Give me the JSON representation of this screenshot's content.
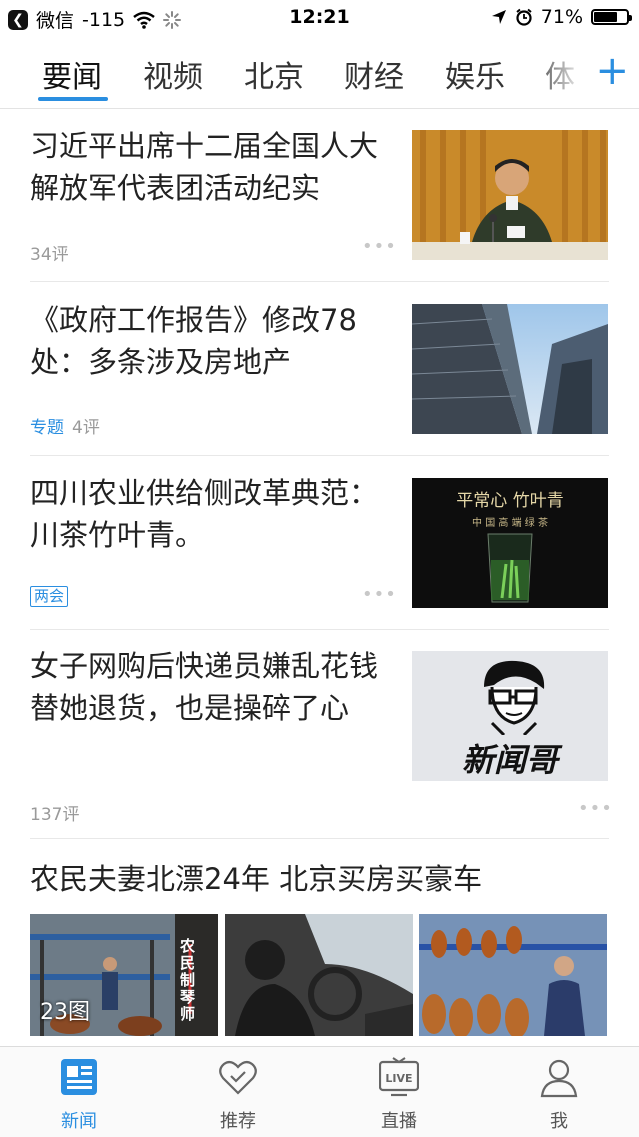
{
  "status_bar": {
    "back_app": "微信",
    "signal": "-115",
    "time": "12:21",
    "battery": "71%",
    "battery_level": 0.71
  },
  "channels": {
    "tabs": [
      "要闻",
      "视频",
      "北京",
      "财经",
      "娱乐",
      "体"
    ],
    "active_index": 0,
    "add_icon": "plus-icon"
  },
  "news": [
    {
      "title": "习近平出席十二届全国人大解放军代表团活动纪实",
      "comments": "34评"
    },
    {
      "title": "《政府工作报告》修改78处：多条涉及房地产",
      "tag": "专题",
      "comments": "4评"
    },
    {
      "title": "四川农业供给侧改革典范：川茶竹叶青。",
      "tag": "两会",
      "thumb_title": "平常心 竹叶青",
      "thumb_sub": "中 国 高 端 绿 茶"
    },
    {
      "title": "女子网购后快递员嫌乱花钱替她退货，也是操碎了心",
      "comments": "137评",
      "thumb_logo": "新闻哥"
    }
  ],
  "photo_set": {
    "title": "农民夫妻北漂24年 北京买房买豪车",
    "count": "23图",
    "poster_text": "农民制琴师"
  },
  "bottom_nav": [
    {
      "label": "新闻",
      "icon": "news-icon"
    },
    {
      "label": "推荐",
      "icon": "heart-check-icon"
    },
    {
      "label": "直播",
      "icon": "live-tv-icon",
      "badge": "LIVE"
    },
    {
      "label": "我",
      "icon": "person-icon"
    }
  ],
  "colors": {
    "accent": "#2a8ee0",
    "text": "#222222",
    "meta": "#9a9a9a"
  }
}
